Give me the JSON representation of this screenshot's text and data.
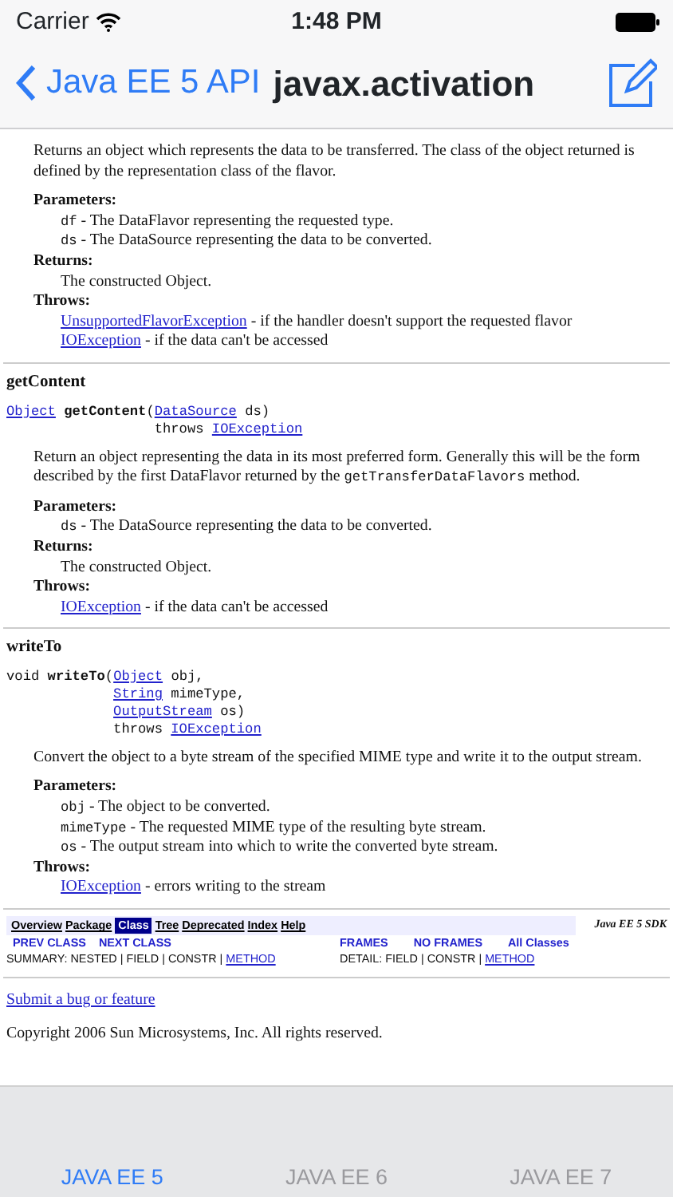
{
  "status_bar": {
    "carrier": "Carrier",
    "time": "1:48 PM"
  },
  "nav_bar": {
    "back_label": "Java EE 5 API",
    "title": "javax.activation"
  },
  "methods": [
    {
      "description": [
        {
          "kind": "text",
          "text": "Returns an object which represents the data to be transferred. The class of the object returned is defined by the representation class of the flavor."
        }
      ],
      "blocks": [
        {
          "heading": "Parameters:",
          "items": [
            [
              {
                "kind": "code",
                "text": "df"
              },
              {
                "kind": "text",
                "text": " - The DataFlavor representing the requested type."
              }
            ],
            [
              {
                "kind": "code",
                "text": "ds"
              },
              {
                "kind": "text",
                "text": " - The DataSource representing the data to be converted."
              }
            ]
          ]
        },
        {
          "heading": "Returns:",
          "items": [
            [
              {
                "kind": "text",
                "text": "The constructed Object."
              }
            ]
          ]
        },
        {
          "heading": "Throws:",
          "items": [
            [
              {
                "kind": "link",
                "text": "UnsupportedFlavorException"
              },
              {
                "kind": "text",
                "text": " - if the handler doesn't support the requested flavor"
              }
            ],
            [
              {
                "kind": "link",
                "text": "IOException"
              },
              {
                "kind": "text",
                "text": " - if the data can't be accessed"
              }
            ]
          ]
        }
      ]
    },
    {
      "name": "getContent",
      "signature": [
        [
          {
            "kind": "link",
            "text": "Object"
          },
          {
            "kind": "bold",
            "text": " getContent"
          },
          {
            "kind": "code",
            "text": "("
          },
          {
            "kind": "link",
            "text": "DataSource"
          },
          {
            "kind": "code",
            "text": " ds)"
          }
        ],
        [
          {
            "kind": "code",
            "text": "throws "
          },
          {
            "kind": "link",
            "text": "IOException"
          }
        ]
      ],
      "description": [
        {
          "kind": "text",
          "text": "Return an object representing the data in its most preferred form. Generally this will be the form described by the first DataFlavor returned by the "
        },
        {
          "kind": "code",
          "text": "getTransferDataFlavors"
        },
        {
          "kind": "text",
          "text": " method."
        }
      ],
      "blocks": [
        {
          "heading": "Parameters:",
          "items": [
            [
              {
                "kind": "code",
                "text": "ds"
              },
              {
                "kind": "text",
                "text": " - The DataSource representing the data to be converted."
              }
            ]
          ]
        },
        {
          "heading": "Returns:",
          "items": [
            [
              {
                "kind": "text",
                "text": "The constructed Object."
              }
            ]
          ]
        },
        {
          "heading": "Throws:",
          "items": [
            [
              {
                "kind": "link",
                "text": "IOException"
              },
              {
                "kind": "text",
                "text": " - if the data can't be accessed"
              }
            ]
          ]
        }
      ]
    },
    {
      "name": "writeTo",
      "signature": [
        [
          {
            "kind": "code",
            "text": "void "
          },
          {
            "kind": "bold",
            "text": "writeTo"
          },
          {
            "kind": "code",
            "text": "("
          },
          {
            "kind": "link",
            "text": "Object"
          },
          {
            "kind": "code",
            "text": " obj,"
          }
        ],
        [
          {
            "kind": "link",
            "text": "String"
          },
          {
            "kind": "code",
            "text": " mimeType,"
          }
        ],
        [
          {
            "kind": "link",
            "text": "OutputStream"
          },
          {
            "kind": "code",
            "text": " os)"
          }
        ],
        [
          {
            "kind": "code",
            "text": "throws "
          },
          {
            "kind": "link",
            "text": "IOException"
          }
        ]
      ],
      "description": [
        {
          "kind": "text",
          "text": "Convert the object to a byte stream of the specified MIME type and write it to the output stream."
        }
      ],
      "blocks": [
        {
          "heading": "Parameters:",
          "items": [
            [
              {
                "kind": "code",
                "text": "obj"
              },
              {
                "kind": "text",
                "text": " - The object to be converted."
              }
            ],
            [
              {
                "kind": "code",
                "text": "mimeType"
              },
              {
                "kind": "text",
                "text": " - The requested MIME type of the resulting byte stream."
              }
            ],
            [
              {
                "kind": "code",
                "text": "os"
              },
              {
                "kind": "text",
                "text": " - The output stream into which to write the converted byte stream."
              }
            ]
          ]
        },
        {
          "heading": "Throws:",
          "items": [
            [
              {
                "kind": "link",
                "text": "IOException"
              },
              {
                "kind": "text",
                "text": " - errors writing to the stream"
              }
            ]
          ]
        }
      ]
    }
  ],
  "footer_nav": {
    "links": [
      {
        "label": "Overview",
        "selected": false
      },
      {
        "label": "Package",
        "selected": false
      },
      {
        "label": "Class",
        "selected": true
      },
      {
        "label": "Tree",
        "selected": false
      },
      {
        "label": "Deprecated",
        "selected": false
      },
      {
        "label": "Index",
        "selected": false
      },
      {
        "label": "Help",
        "selected": false
      }
    ],
    "sdk_label": "Java EE 5 SDK",
    "left_links": [
      "PREV CLASS",
      "NEXT CLASS"
    ],
    "right_links": [
      "FRAMES",
      "NO FRAMES",
      "All Classes"
    ],
    "summary": [
      {
        "kind": "text",
        "text": "SUMMARY: NESTED | FIELD | CONSTR | "
      },
      {
        "kind": "link",
        "text": "METHOD"
      }
    ],
    "detail": [
      {
        "kind": "text",
        "text": "DETAIL: FIELD | CONSTR | "
      },
      {
        "kind": "link",
        "text": "METHOD"
      }
    ]
  },
  "submit_link": "Submit a bug or feature",
  "copyright": "Copyright 2006 Sun Microsystems, Inc. All rights reserved.",
  "tabs": [
    {
      "label": "JAVA EE 5",
      "selected": true
    },
    {
      "label": "JAVA EE 6",
      "selected": false
    },
    {
      "label": "JAVA EE 7",
      "selected": false
    }
  ]
}
